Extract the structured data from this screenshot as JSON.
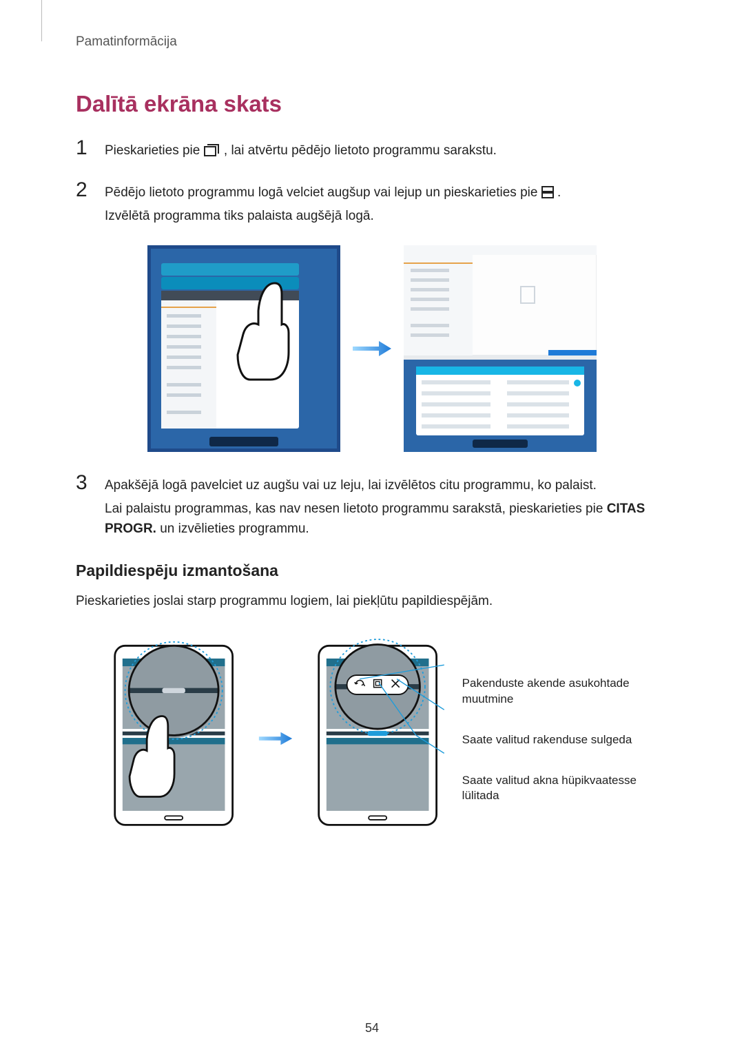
{
  "header": {
    "breadcrumb": "Pamatinformācija"
  },
  "title": "Dalītā ekrāna skats",
  "step1": {
    "text_a": "Pieskarieties pie ",
    "text_b": ", lai atvērtu pēdējo lietoto programmu sarakstu."
  },
  "step2": {
    "line1_a": "Pēdējo lietoto programmu logā velciet augšup vai lejup un pieskarieties pie ",
    "line1_b": ".",
    "line2": "Izvēlētā programma tiks palaista augšējā logā."
  },
  "step3": {
    "line1": "Apakšējā logā pavelciet uz augšu vai uz leju, lai izvēlētos citu programmu, ko palaist.",
    "line2_a": "Lai palaistu programmas, kas nav nesen lietoto programmu sarakstā, pieskarieties pie ",
    "line2_bold": "CITAS PROGR.",
    "line2_b": " un izvēlieties programmu."
  },
  "sub_title": "Papildiespēju izmantošana",
  "sub_body": "Pieskarieties joslai starp programmu logiem, lai piekļūtu papildiespējām.",
  "labels": {
    "swap": "Pakenduste akende asukohtade muutmine",
    "close": "Saate valitud rakenduse sulgeda",
    "popup": "Saate valitud akna hüpikvaatesse lülitada"
  },
  "page_number": "54"
}
